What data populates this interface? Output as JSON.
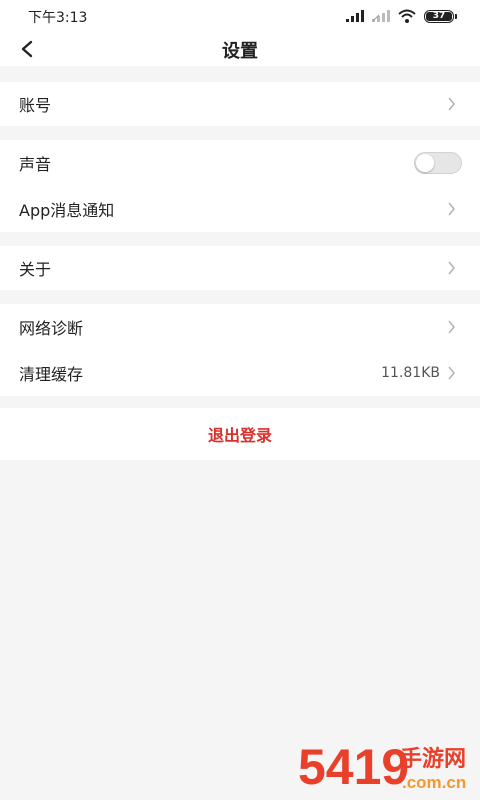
{
  "status_bar": {
    "time": "下午3:13",
    "battery_level": "37",
    "icons": [
      "signal-icon",
      "signal-weak-icon",
      "wifi-icon",
      "battery-icon"
    ]
  },
  "nav": {
    "title": "设置",
    "back_icon": "chevron-left-icon"
  },
  "sections": {
    "account": {
      "label": "账号"
    },
    "sound": {
      "label": "声音",
      "toggle_on": false
    },
    "app_notify": {
      "label": "App消息通知"
    },
    "about": {
      "label": "关于"
    },
    "network": {
      "label": "网络诊断"
    },
    "cache": {
      "label": "清理缓存",
      "value": "11.81KB"
    }
  },
  "logout": {
    "label": "退出登录"
  },
  "watermark": {
    "text_main": "5419",
    "text_cn": "手游网",
    "text_domain": ".com.cn"
  },
  "colors": {
    "background": "#f5f5f5",
    "card": "#ffffff",
    "logout": "#d9302c",
    "chevron": "#b5b5b5",
    "watermark_red": "#e8402a",
    "watermark_orange": "#f29a2e"
  }
}
